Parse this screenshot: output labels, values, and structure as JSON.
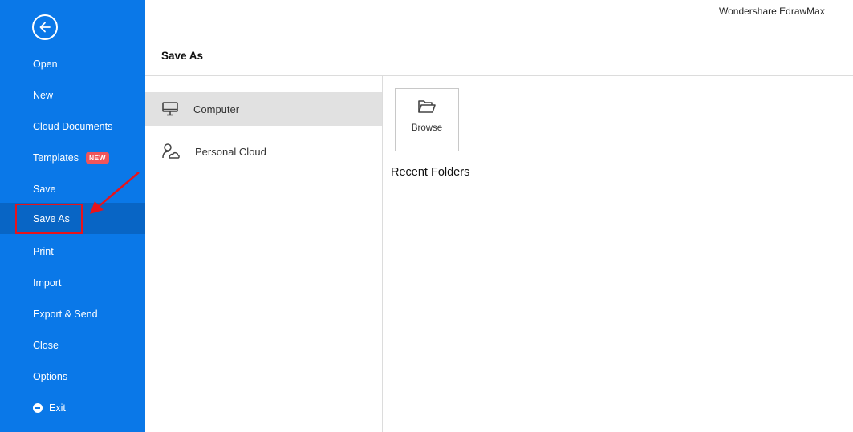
{
  "app": {
    "title": "Wondershare EdrawMax"
  },
  "sidebar": {
    "back_icon": "arrow-left-circle-icon",
    "items": [
      {
        "label": "Open"
      },
      {
        "label": "New"
      },
      {
        "label": "Cloud Documents"
      },
      {
        "label": "Templates",
        "badge": "NEW"
      },
      {
        "label": "Save"
      },
      {
        "label": "Save As",
        "active": true
      },
      {
        "label": "Print"
      },
      {
        "label": "Import"
      },
      {
        "label": "Export & Send"
      },
      {
        "label": "Close"
      },
      {
        "label": "Options"
      },
      {
        "label": "Exit",
        "icon": "minus-circle-icon"
      }
    ]
  },
  "main": {
    "title": "Save As",
    "locations": [
      {
        "label": "Computer",
        "icon": "monitor-icon",
        "selected": true
      },
      {
        "label": "Personal Cloud",
        "icon": "person-cloud-icon",
        "selected": false
      }
    ],
    "browse": {
      "label": "Browse",
      "icon": "folder-open-icon"
    },
    "recent_folders_title": "Recent Folders"
  },
  "annotation": {
    "color": "#e8131b"
  },
  "colors": {
    "sidebar_bg": "#0a78e8",
    "sidebar_active": "#0865c5",
    "badge": "#f0555a"
  }
}
